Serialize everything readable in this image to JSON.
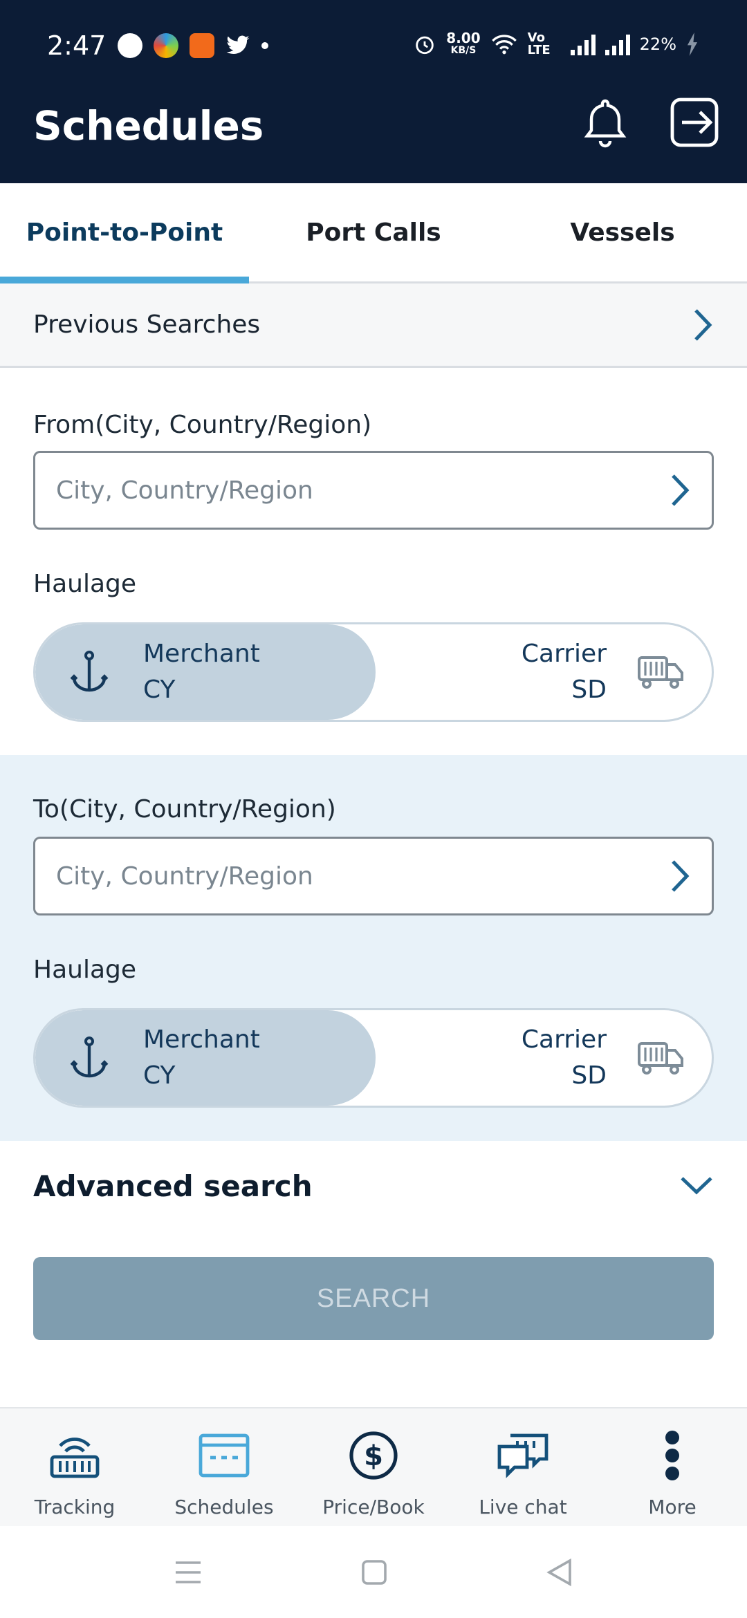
{
  "status_bar": {
    "time": "2:47",
    "speed_value": "8.00",
    "speed_unit": "KB/S",
    "volte": "Vo LTE",
    "battery": "22%"
  },
  "header": {
    "title": "Schedules",
    "icons": [
      "bell-icon",
      "logout-icon"
    ]
  },
  "tabs": [
    {
      "label": "Point-to-Point",
      "active": true
    },
    {
      "label": "Port Calls",
      "active": false
    },
    {
      "label": "Vessels",
      "active": false
    }
  ],
  "previous_searches": {
    "label": "Previous Searches"
  },
  "from": {
    "label": "From(City, Country/Region)",
    "placeholder": "City, Country/Region",
    "haulage_label": "Haulage",
    "merchant_line1": "Merchant",
    "merchant_line2": "CY",
    "carrier_line1": "Carrier",
    "carrier_line2": "SD"
  },
  "to": {
    "label": "To(City, Country/Region)",
    "placeholder": "City, Country/Region",
    "haulage_label": "Haulage",
    "merchant_line1": "Merchant",
    "merchant_line2": "CY",
    "carrier_line1": "Carrier",
    "carrier_line2": "SD"
  },
  "advanced": {
    "label": "Advanced search"
  },
  "search_button": {
    "label": "SEARCH"
  },
  "bottom_nav": [
    {
      "label": "Tracking",
      "icon": "tracking-icon"
    },
    {
      "label": "Schedules",
      "icon": "schedules-icon"
    },
    {
      "label": "Price/Book",
      "icon": "price-icon"
    },
    {
      "label": "Live chat",
      "icon": "chat-icon"
    },
    {
      "label": "More",
      "icon": "more-icon"
    }
  ],
  "colors": {
    "header_bg": "#0c1c36",
    "accent": "#49a8d9",
    "active_tab_text": "#0c3b5d",
    "to_section_bg": "#e8f2f9",
    "search_button_bg": "#7f9daf"
  }
}
